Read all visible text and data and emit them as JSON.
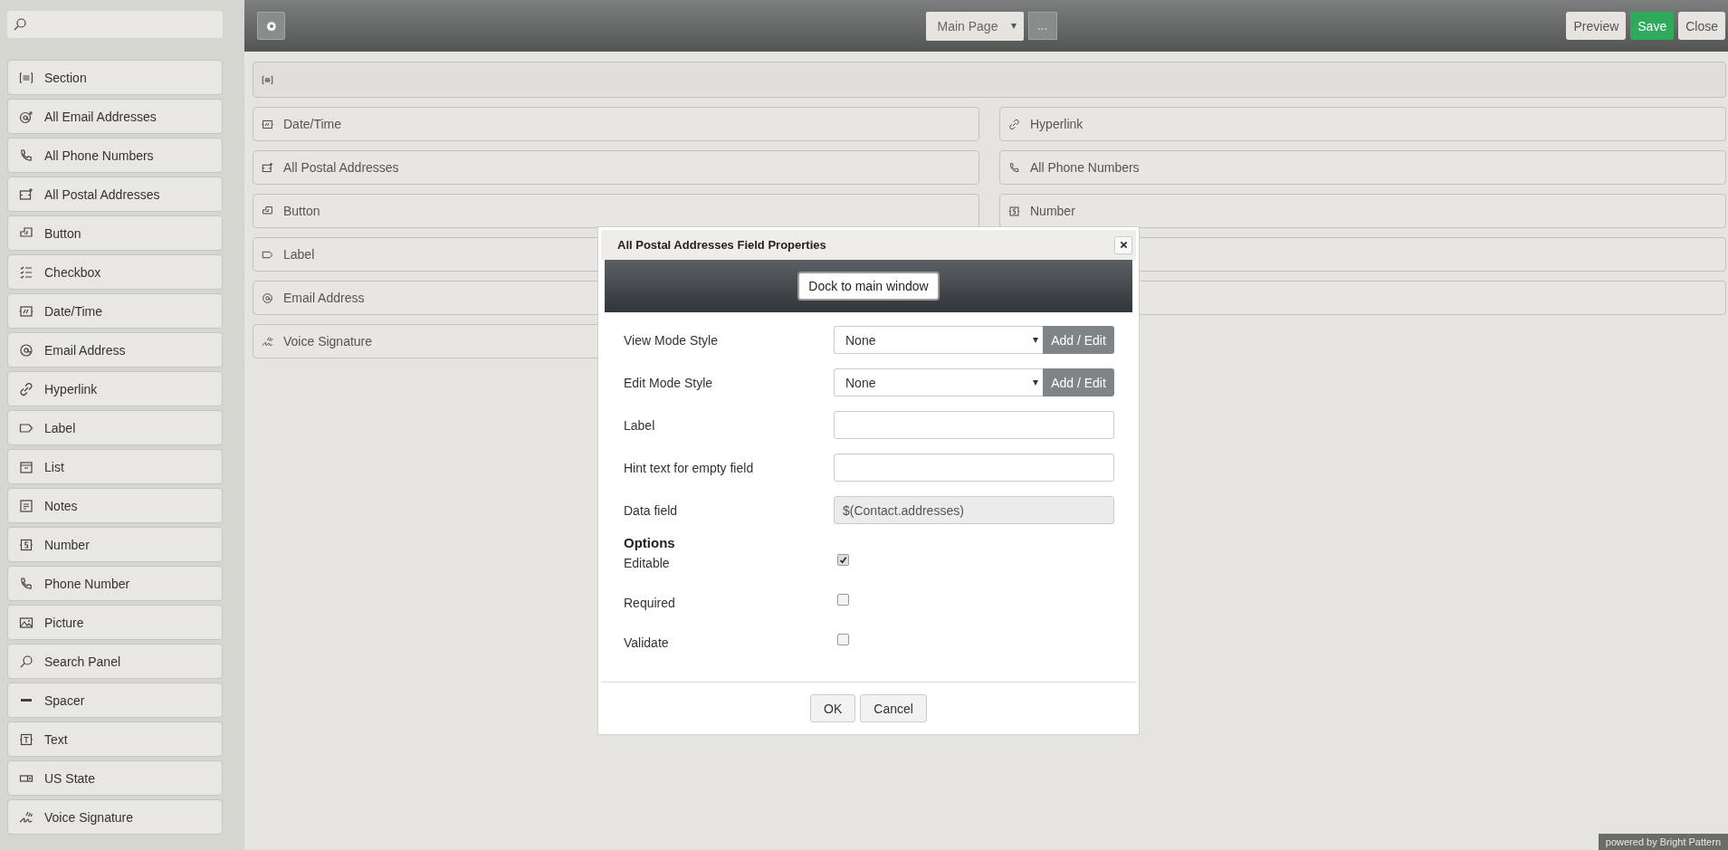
{
  "sidebar": {
    "items": [
      {
        "kind": "section",
        "label": "Section"
      },
      {
        "kind": "all-email",
        "label": "All Email Addresses"
      },
      {
        "kind": "all-phone",
        "label": "All Phone Numbers"
      },
      {
        "kind": "all-postal",
        "label": "All Postal Addresses"
      },
      {
        "kind": "button",
        "label": "Button"
      },
      {
        "kind": "checkbox",
        "label": "Checkbox"
      },
      {
        "kind": "datetime",
        "label": "Date/Time"
      },
      {
        "kind": "email",
        "label": "Email Address"
      },
      {
        "kind": "hyperlink",
        "label": "Hyperlink"
      },
      {
        "kind": "label",
        "label": "Label"
      },
      {
        "kind": "list",
        "label": "List"
      },
      {
        "kind": "notes",
        "label": "Notes"
      },
      {
        "kind": "number",
        "label": "Number"
      },
      {
        "kind": "phone",
        "label": "Phone Number"
      },
      {
        "kind": "picture",
        "label": "Picture"
      },
      {
        "kind": "search",
        "label": "Search Panel"
      },
      {
        "kind": "spacer",
        "label": "Spacer"
      },
      {
        "kind": "text",
        "label": "Text"
      },
      {
        "kind": "us-state",
        "label": "US State"
      },
      {
        "kind": "voice",
        "label": "Voice Signature"
      }
    ]
  },
  "toolbar": {
    "page_select": "Main Page",
    "more_button": "...",
    "buttons": [
      {
        "kind": "plain",
        "label": "Preview"
      },
      {
        "kind": "primary",
        "label": "Save"
      },
      {
        "kind": "plain",
        "label": "Close"
      }
    ]
  },
  "canvas": {
    "section": {
      "kind": "section"
    },
    "left_column": [
      {
        "kind": "datetime",
        "label": "Date/Time"
      },
      {
        "kind": "all-postal",
        "label": "All Postal Addresses"
      },
      {
        "kind": "button",
        "label": "Button"
      },
      {
        "kind": "label",
        "label": "Label"
      },
      {
        "kind": "email",
        "label": "Email Address"
      },
      {
        "kind": "voice",
        "label": "Voice Signature"
      }
    ],
    "right_column": [
      {
        "kind": "hyperlink",
        "label": "Hyperlink"
      },
      {
        "kind": "all-phone",
        "label": "All Phone Numbers"
      },
      {
        "kind": "number",
        "label": "Number"
      },
      {
        "kind": "covered"
      },
      {
        "kind": "covered"
      }
    ]
  },
  "dialog": {
    "title": "All Postal Addresses Field Properties",
    "dock_button": "Dock to main window",
    "fields": [
      {
        "kind": "select",
        "label": "View Mode Style",
        "value": "None",
        "button": "Add / Edit"
      },
      {
        "kind": "select",
        "label": "Edit Mode Style",
        "value": "None",
        "button": "Add / Edit"
      },
      {
        "kind": "input",
        "label": "Label"
      },
      {
        "kind": "input",
        "label": "Hint text for empty field"
      },
      {
        "kind": "readonly",
        "label": "Data field",
        "value": "$(Contact.addresses)"
      }
    ],
    "options_heading": "Options",
    "options": [
      {
        "label": "Editable",
        "checked": true
      },
      {
        "label": "Required",
        "checked": false
      },
      {
        "label": "Validate",
        "checked": false
      }
    ],
    "buttons": [
      "OK",
      "Cancel"
    ]
  },
  "footer": "powered by Bright Pattern"
}
